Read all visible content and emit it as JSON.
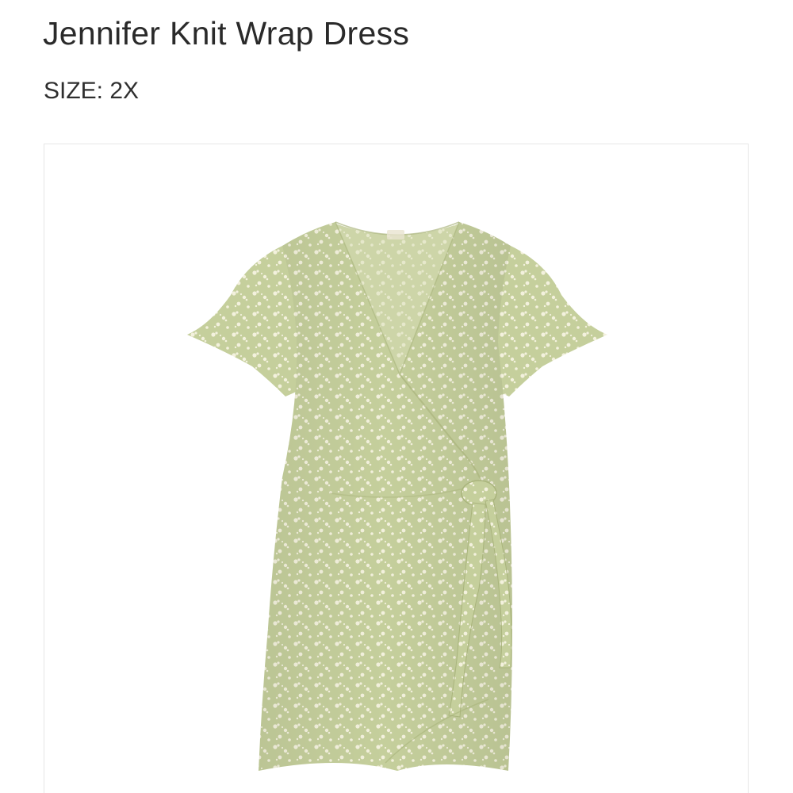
{
  "product": {
    "title": "Jennifer Knit Wrap Dress",
    "size_label": "SIZE:",
    "size_value": "2X"
  },
  "image": {
    "subject": "sage green wrap dress with white floral print",
    "colors": {
      "fabric": "#c5cf9c",
      "fabric_shadow": "#b3bd88",
      "print": "#f3f1dd",
      "background": "#ffffff"
    }
  }
}
